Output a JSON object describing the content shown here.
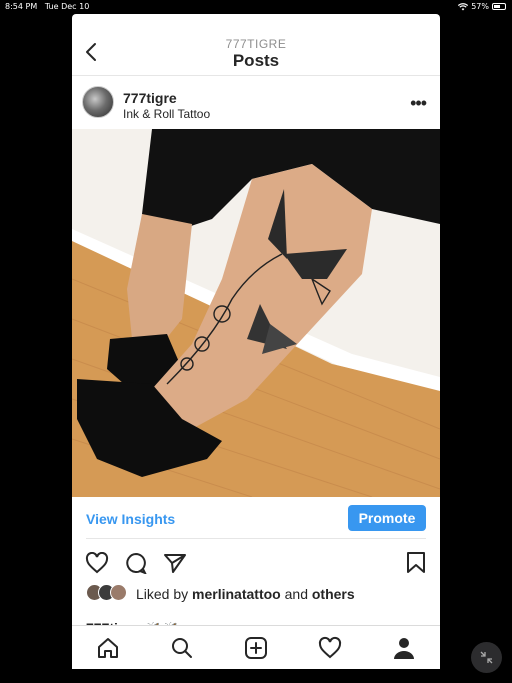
{
  "status_bar": {
    "time": "8:54 PM",
    "date": "Tue Dec 10",
    "battery": "57%",
    "battery_level": 0.57
  },
  "navbar": {
    "subtitle": "777TIGRE",
    "title": "Posts"
  },
  "post": {
    "username": "777tigre",
    "location": "Ink & Roll Tattoo",
    "image_description_icon": "photo-butterfly-tattoo",
    "insights_label": "View Insights",
    "promote_label": "Promote",
    "liked_prefix": "Liked by",
    "liked_user": "merlinatattoo",
    "liked_and": "and",
    "liked_others": "others",
    "caption_user": "777tigre",
    "caption_emoji": "🦋🦋"
  },
  "colors": {
    "accent": "#3897f0",
    "text": "#262626",
    "muted": "#8e8e8e"
  }
}
